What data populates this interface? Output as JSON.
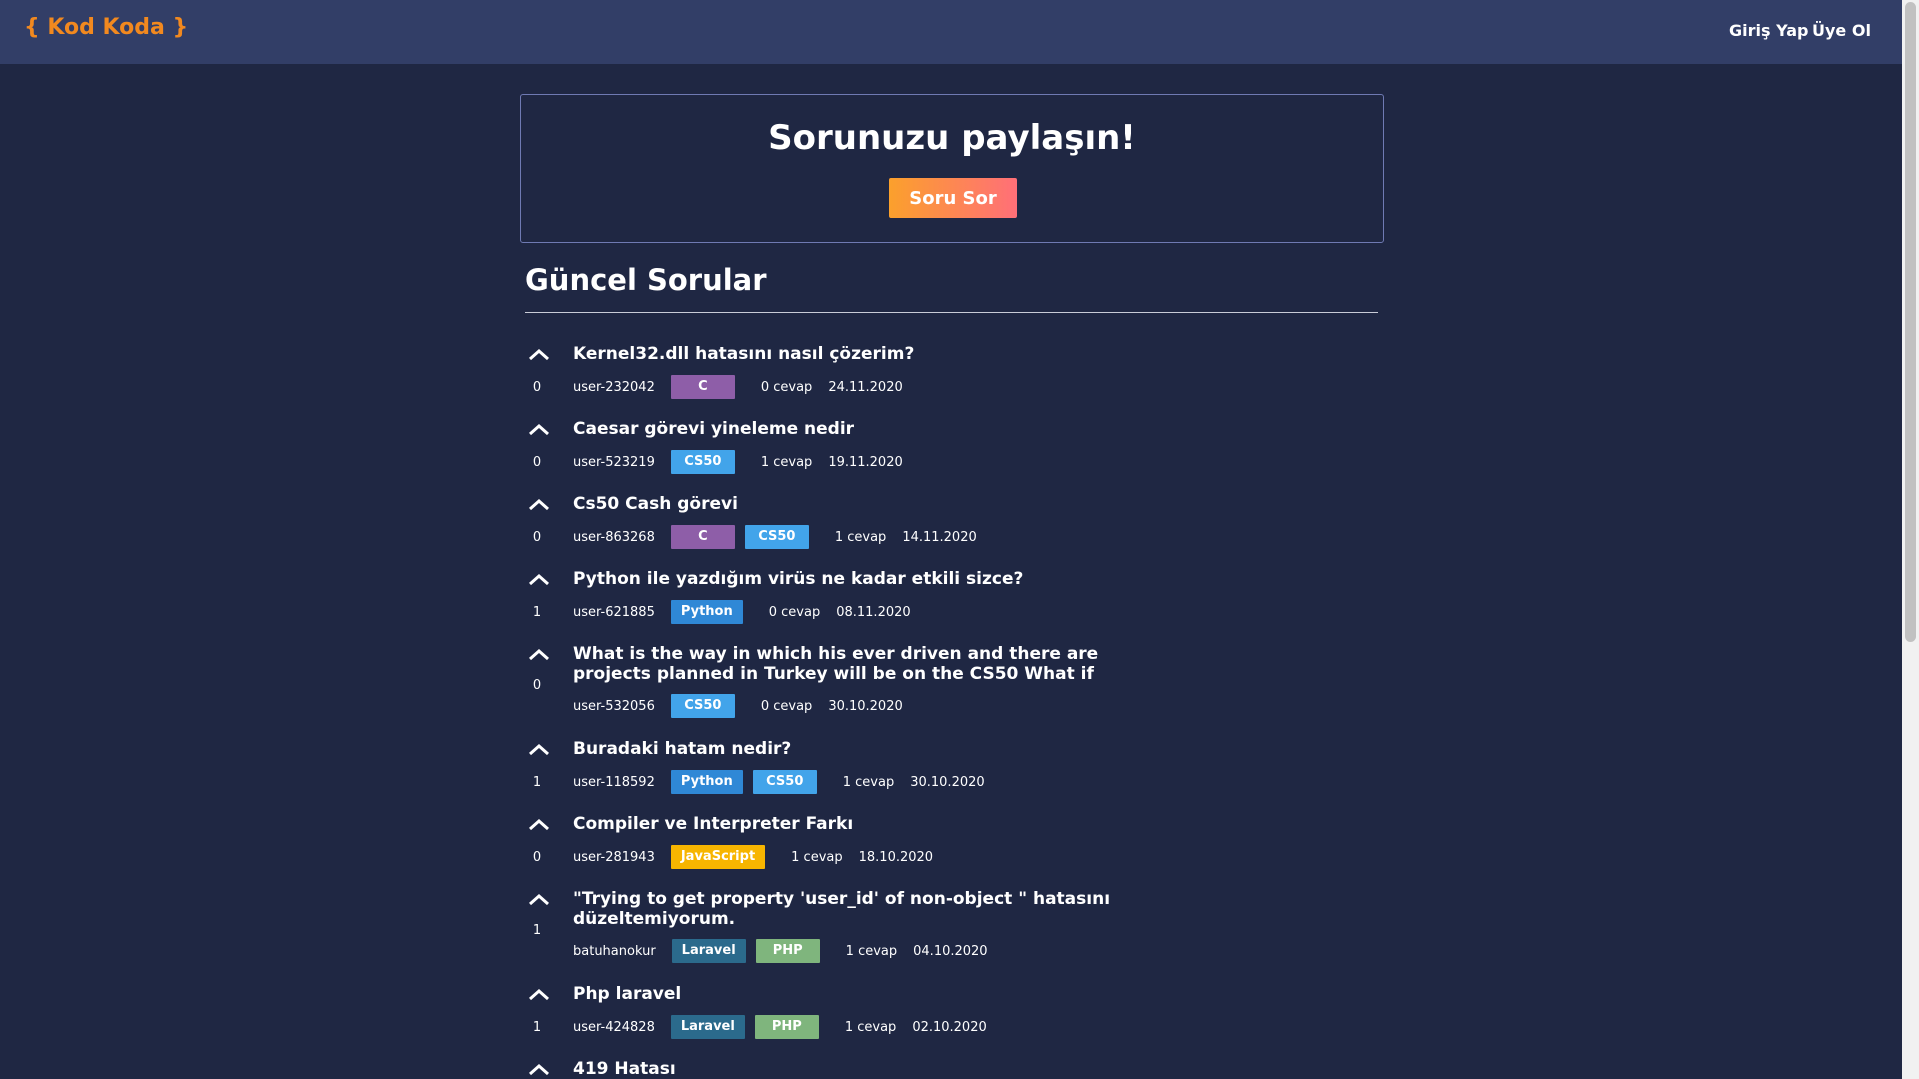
{
  "brand": "{ Kod Koda }",
  "nav": {
    "login": "Giriş Yap",
    "register": "Üye Ol"
  },
  "hero": {
    "title": "Sorunuzu paylaşın!",
    "button": "Soru Sor"
  },
  "section_title": "Güncel Sorular",
  "colors": {
    "navbar": "#323e67",
    "background": "#1f2743",
    "brand": "#f2891f",
    "tag_C": "#8e5ea8",
    "tag_CS50": "#42a4ea",
    "tag_Python": "#2f88d6",
    "tag_JavaScript": "#f7b500",
    "tag_Laravel": "#2b6a8c",
    "tag_PHP": "#7fb57d"
  },
  "questions": [
    {
      "votes": "0",
      "title": "Kernel32.dll hatasını nasıl çözerim?",
      "user": "user-232042",
      "tags": [
        "C"
      ],
      "answers": "0 cevap",
      "date": "24.11.2020"
    },
    {
      "votes": "0",
      "title": "Caesar görevi yineleme nedir",
      "user": "user-523219",
      "tags": [
        "CS50"
      ],
      "answers": "1 cevap",
      "date": "19.11.2020"
    },
    {
      "votes": "0",
      "title": "Cs50 Cash görevi",
      "user": "user-863268",
      "tags": [
        "C",
        "CS50"
      ],
      "answers": "1 cevap",
      "date": "14.11.2020"
    },
    {
      "votes": "1",
      "title": "Python ile yazdığım virüs ne kadar etkili sizce?",
      "user": "user-621885",
      "tags": [
        "Python"
      ],
      "answers": "0 cevap",
      "date": "08.11.2020"
    },
    {
      "votes": "0",
      "title": "What is the way in which his ever driven and there are projects planned in Turkey will be on the CS50 What if",
      "user": "user-532056",
      "tags": [
        "CS50"
      ],
      "answers": "0 cevap",
      "date": "30.10.2020"
    },
    {
      "votes": "1",
      "title": "Buradaki hatam nedir?",
      "user": "user-118592",
      "tags": [
        "Python",
        "CS50"
      ],
      "answers": "1 cevap",
      "date": "30.10.2020"
    },
    {
      "votes": "0",
      "title": "Compiler ve Interpreter Farkı",
      "user": "user-281943",
      "tags": [
        "JavaScript"
      ],
      "answers": "1 cevap",
      "date": "18.10.2020"
    },
    {
      "votes": "1",
      "title": "\"Trying to get property 'user_id' of non-object \" hatasını düzeltemiyorum.",
      "user": "batuhanokur",
      "tags": [
        "Laravel",
        "PHP"
      ],
      "answers": "1 cevap",
      "date": "04.10.2020"
    },
    {
      "votes": "1",
      "title": "Php laravel",
      "user": "user-424828",
      "tags": [
        "Laravel",
        "PHP"
      ],
      "answers": "1 cevap",
      "date": "02.10.2020"
    },
    {
      "votes": "",
      "title": "419 Hatası",
      "user": "",
      "tags": [],
      "answers": "",
      "date": ""
    }
  ]
}
